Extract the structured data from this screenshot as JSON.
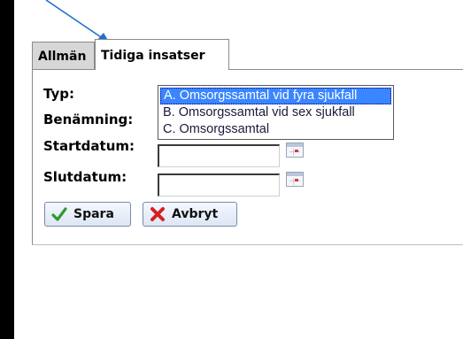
{
  "tabs": [
    {
      "label": "Allmän",
      "active": false
    },
    {
      "label": "Tidiga insatser",
      "active": true
    }
  ],
  "form": {
    "type_label": "Typ:",
    "name_label": "Benämning:",
    "start_label": "Startdatum:",
    "end_label": "Slutdatum:",
    "start_value": "",
    "end_value": ""
  },
  "dropdown": {
    "options": [
      "A. Omsorgssamtal vid fyra sjukfall",
      "B. Omsorgssamtal vid sex sjukfall",
      "C. Omsorgssamtal"
    ],
    "selected_index": 0
  },
  "buttons": {
    "save_label": "Spara",
    "cancel_label": "Avbryt"
  },
  "icons": {
    "save": "checkmark-icon",
    "cancel": "red-x-icon",
    "date_picker": "calendar-icon",
    "annotation": "arrow-icon"
  },
  "colors": {
    "selection": "#3a86ff",
    "arrow": "#1f6fd1",
    "check": "#2e9a2e",
    "cancel_x": "#d62020"
  }
}
